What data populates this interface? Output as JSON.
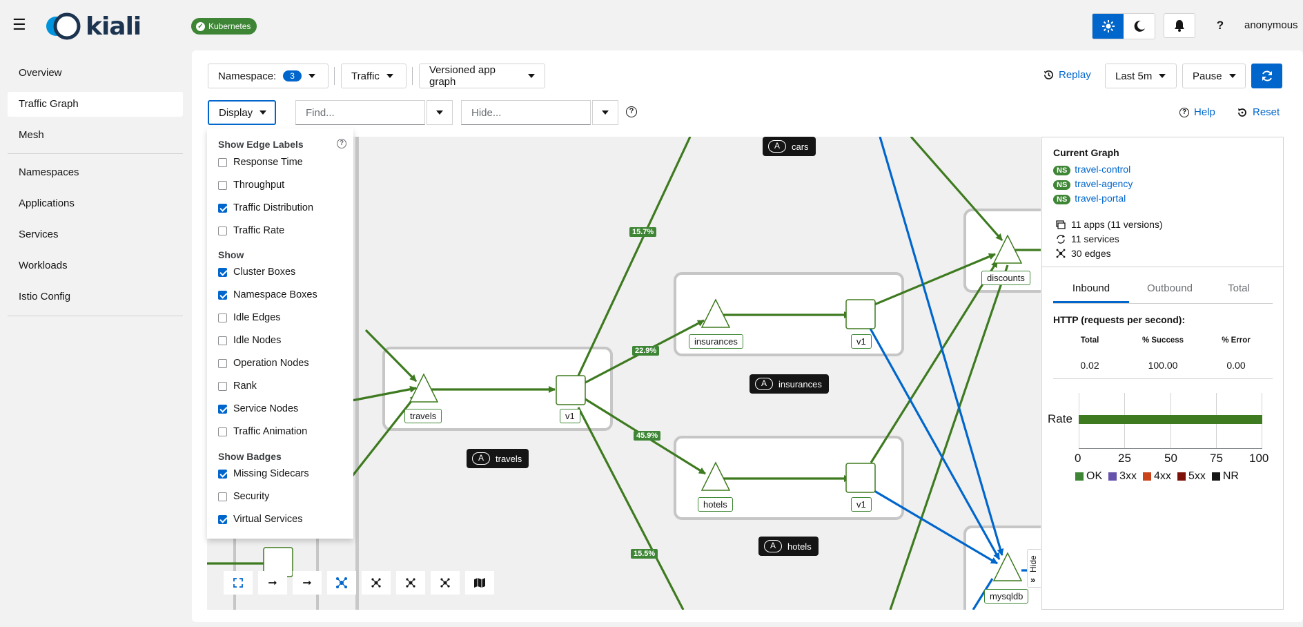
{
  "masthead": {
    "brand": "kiali",
    "platform_badge": "Kubernetes",
    "user": "anonymous"
  },
  "sidebar": {
    "items": [
      {
        "label": "Overview"
      },
      {
        "label": "Traffic Graph"
      },
      {
        "label": "Mesh"
      },
      {
        "label": "Namespaces"
      },
      {
        "label": "Applications"
      },
      {
        "label": "Services"
      },
      {
        "label": "Workloads"
      },
      {
        "label": "Istio Config"
      }
    ]
  },
  "toolbar": {
    "namespace_label": "Namespace:",
    "namespace_count": "3",
    "traffic_label": "Traffic",
    "graph_type": "Versioned app graph",
    "replay_label": "Replay",
    "duration": "Last 5m",
    "refresh_interval": "Pause",
    "display_label": "Display",
    "find_placeholder": "Find...",
    "hide_placeholder": "Hide...",
    "help_label": "Help",
    "reset_label": "Reset"
  },
  "display_menu": {
    "edge_labels_title": "Show Edge Labels",
    "edge_labels": [
      {
        "label": "Response Time",
        "checked": false
      },
      {
        "label": "Throughput",
        "checked": false
      },
      {
        "label": "Traffic Distribution",
        "checked": true
      },
      {
        "label": "Traffic Rate",
        "checked": false
      }
    ],
    "show_title": "Show",
    "show": [
      {
        "label": "Cluster Boxes",
        "checked": true
      },
      {
        "label": "Namespace Boxes",
        "checked": true
      },
      {
        "label": "Idle Edges",
        "checked": false
      },
      {
        "label": "Idle Nodes",
        "checked": false
      },
      {
        "label": "Operation Nodes",
        "checked": false
      },
      {
        "label": "Rank",
        "checked": false
      },
      {
        "label": "Service Nodes",
        "checked": true
      },
      {
        "label": "Traffic Animation",
        "checked": false
      }
    ],
    "badges_title": "Show Badges",
    "badges": [
      {
        "label": "Missing Sidecars",
        "checked": true
      },
      {
        "label": "Security",
        "checked": false
      },
      {
        "label": "Virtual Services",
        "checked": true
      }
    ]
  },
  "graph": {
    "apps": {
      "cars": "cars",
      "insurances": "insurances",
      "travels": "travels",
      "hotels": "hotels"
    },
    "app_badge": "A",
    "node_labels": {
      "insurances": "insurances",
      "insurances_v1": "v1",
      "travels": "travels",
      "travels_v1": "v1",
      "hotels": "hotels",
      "hotels_v1": "v1",
      "discounts": "discounts",
      "mysqldb": "mysqldb"
    },
    "edge_labels": {
      "e1": "15.7%",
      "e2": "22.9%",
      "e3": "45.9%",
      "e4": "15.5%"
    },
    "hide_tab": "Hide"
  },
  "panel": {
    "title": "Current Graph",
    "ns_badge": "NS",
    "namespaces": [
      "travel-control",
      "travel-agency",
      "travel-portal"
    ],
    "apps_stat": "11 apps (11 versions)",
    "services_stat": "11 services",
    "edges_stat": "30 edges",
    "tabs": [
      "Inbound",
      "Outbound",
      "Total"
    ],
    "http_title": "HTTP (requests per second):",
    "columns": [
      "Total",
      "% Success",
      "% Error"
    ],
    "values": [
      "0.02",
      "100.00",
      "0.00"
    ],
    "rate_label": "Rate",
    "ticks": [
      "0",
      "25",
      "50",
      "75",
      "100"
    ],
    "legend": [
      {
        "label": "OK",
        "color": "#3e8635"
      },
      {
        "label": "3xx",
        "color": "#6753ac"
      },
      {
        "label": "4xx",
        "color": "#c9431b"
      },
      {
        "label": "5xx",
        "color": "#7d1007"
      },
      {
        "label": "NR",
        "color": "#151515"
      }
    ],
    "ok_fraction": 1.0
  }
}
